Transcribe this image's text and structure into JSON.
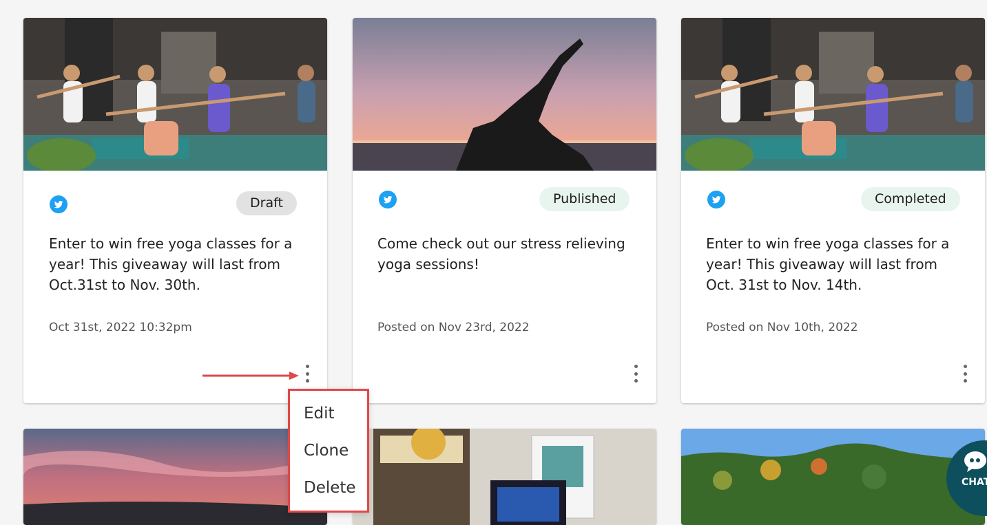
{
  "cards": [
    {
      "status": "Draft",
      "description": "Enter to win free yoga classes for a year! This giveaway will last from Oct.31st to Nov. 30th.",
      "date": "Oct 31st, 2022 10:32pm",
      "platform_icon": "twitter-icon",
      "image": "group-yoga-class"
    },
    {
      "status": "Published",
      "description": "Come check out our stress relieving yoga sessions!",
      "date": "Posted on Nov 23rd, 2022",
      "platform_icon": "twitter-icon",
      "image": "sunset-yoga-silhouette"
    },
    {
      "status": "Completed",
      "description": "Enter to win free yoga classes for a year! This giveaway will last from Oct. 31st to Nov. 14th.",
      "date": "Posted on Nov 10th, 2022",
      "platform_icon": "twitter-icon",
      "image": "group-yoga-class"
    }
  ],
  "context_menu": {
    "items": [
      "Edit",
      "Clone",
      "Delete"
    ]
  },
  "chat_widget": {
    "label": "CHAT"
  },
  "colors": {
    "twitter": "#1da1f2",
    "draft_badge": "#e2e2e2",
    "status_badge": "#e8f5ee",
    "menu_highlight": "#e04848",
    "chat": "#0d4f5c"
  }
}
